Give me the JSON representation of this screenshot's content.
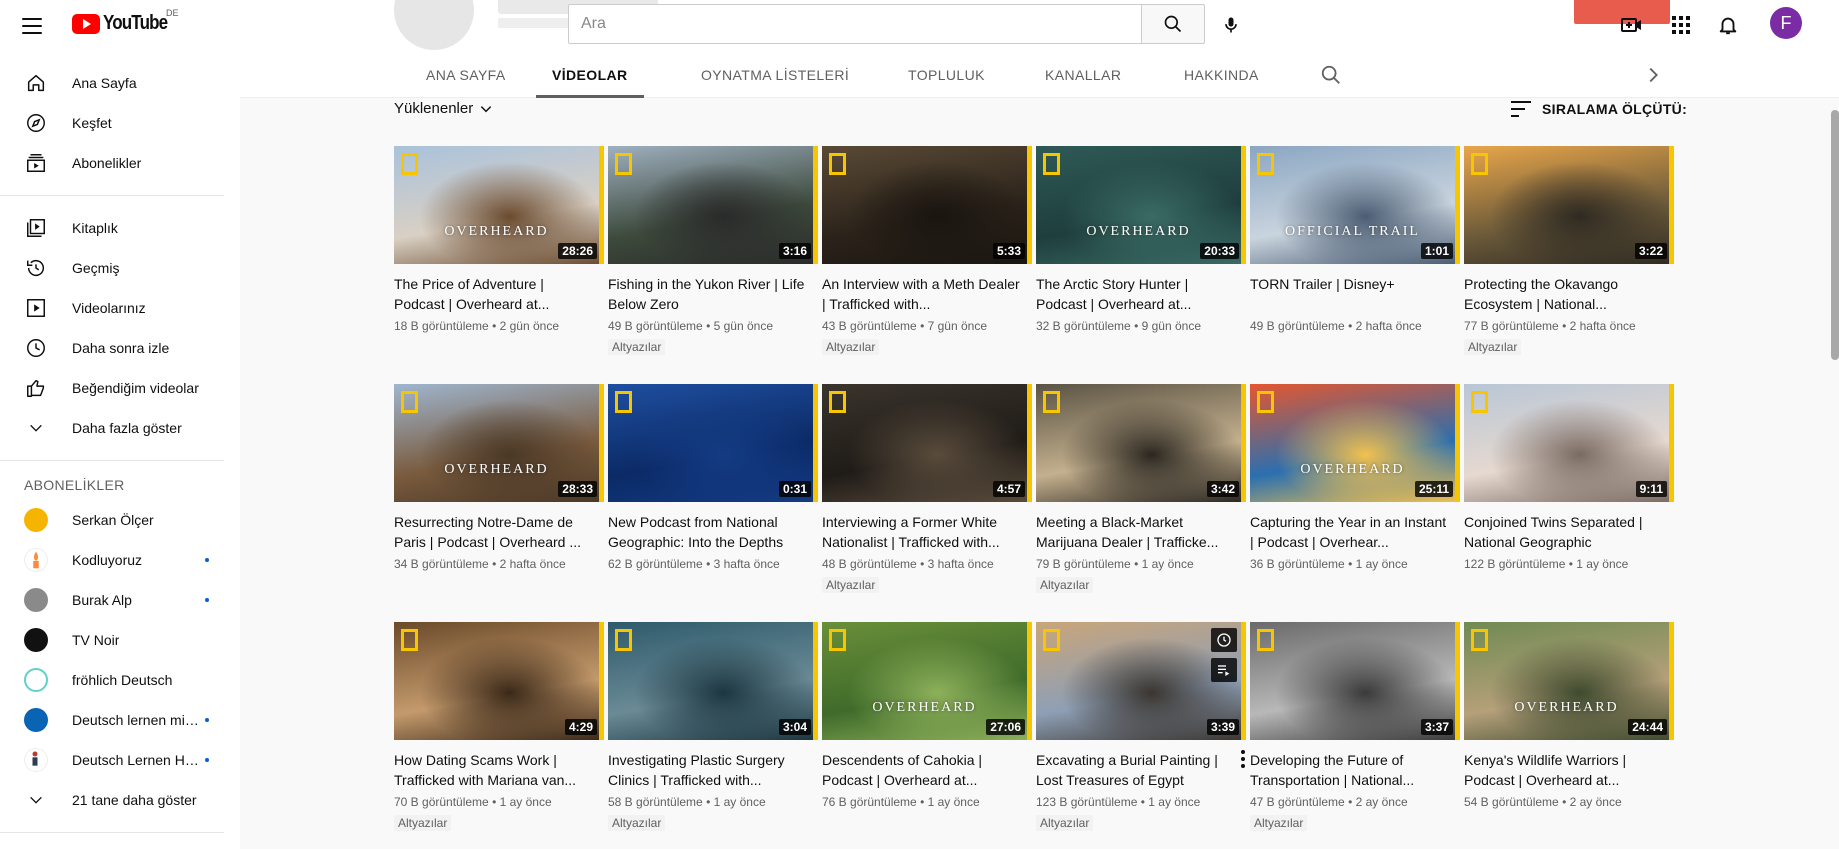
{
  "app": {
    "logo_text": "YouTube",
    "country_code": "DE",
    "avatar_letter": "F",
    "avatar_color": "#7b2ca5",
    "accent": "#ff0000"
  },
  "search": {
    "placeholder": "Ara",
    "value": ""
  },
  "sidebar": {
    "primary": [
      {
        "label": "Ana Sayfa",
        "icon": "home-icon"
      },
      {
        "label": "Keşfet",
        "icon": "compass-icon"
      },
      {
        "label": "Abonelikler",
        "icon": "subscriptions-icon"
      }
    ],
    "library": [
      {
        "label": "Kitaplık",
        "icon": "library-icon"
      },
      {
        "label": "Geçmiş",
        "icon": "history-icon"
      },
      {
        "label": "Videolarınız",
        "icon": "your-videos-icon"
      },
      {
        "label": "Daha sonra izle",
        "icon": "clock-icon"
      },
      {
        "label": "Beğendiğim videolar",
        "icon": "thumbs-up-icon"
      },
      {
        "label": "Daha fazla göster",
        "icon": "chevron-down-icon"
      }
    ],
    "subs_heading": "ABONELİKLER",
    "subscriptions": [
      {
        "label": "Serkan Ölçer",
        "color": "#f4b400",
        "dot": false
      },
      {
        "label": "Kodluyoruz",
        "color": "#ff8a3d",
        "dot": true
      },
      {
        "label": "Burak Alp",
        "color": "#8a8a8a",
        "dot": true
      },
      {
        "label": "TV Noir",
        "color": "#111111",
        "dot": false
      },
      {
        "label": "fröhlich Deutsch",
        "color": "#5fd1c8",
        "dot": false
      },
      {
        "label": "Deutsch lernen mit...",
        "color": "#0a64b4",
        "dot": true
      },
      {
        "label": "Deutsch Lernen Ha...",
        "color": "#c0392b",
        "dot": true
      }
    ],
    "show_more": "21 tane daha göster"
  },
  "tabs": [
    {
      "label": "ANA SAYFA",
      "active": false
    },
    {
      "label": "VİDEOLAR",
      "active": true
    },
    {
      "label": "OYNATMA LİSTELERİ",
      "active": false
    },
    {
      "label": "TOPLULUK",
      "active": false
    },
    {
      "label": "KANALLAR",
      "active": false
    },
    {
      "label": "HAKKINDA",
      "active": false
    }
  ],
  "filter_label": "Yüklenenler",
  "sort_label": "SIRALAMA ÖLÇÜTÜ:",
  "videos": [
    {
      "title": "The Price of Adventure | Podcast | Overheard at...",
      "views": "18 B görüntüleme",
      "age": "2 gün önce",
      "duration": "28:26",
      "captions": "",
      "overlay": "OVERHEARD",
      "colors": [
        "#a9c2dc",
        "#d9d0c4",
        "#6b4b2f"
      ]
    },
    {
      "title": "Fishing in the Yukon River | Life Below Zero",
      "views": "49 B görüntüleme",
      "age": "5 gün önce",
      "duration": "3:16",
      "captions": "Altyazılar",
      "overlay": "",
      "colors": [
        "#9fb0c0",
        "#3d4a3c",
        "#2a2a2a"
      ]
    },
    {
      "title": "An Interview with a Meth Dealer | Trafficked with...",
      "views": "43 B görüntüleme",
      "age": "7 gün önce",
      "duration": "5:33",
      "captions": "Altyazılar",
      "overlay": "",
      "colors": [
        "#5a4a36",
        "#2b231a",
        "#1a1510"
      ]
    },
    {
      "title": "The Arctic Story Hunter | Podcast | Overheard at...",
      "views": "32 B görüntüleme",
      "age": "9 gün önce",
      "duration": "20:33",
      "captions": "",
      "overlay": "OVERHEARD",
      "colors": [
        "#2f5a57",
        "#1e3e3c",
        "#3a6b66"
      ]
    },
    {
      "title": "TORN Trailer | Disney+",
      "views": "49 B görüntüleme",
      "age": "2 hafta önce",
      "duration": "1:01",
      "captions": "",
      "overlay": "OFFICIAL TRAIL",
      "colors": [
        "#8ba6c2",
        "#c9d4de",
        "#4b5d73"
      ]
    },
    {
      "title": "Protecting the Okavango Ecosystem | National...",
      "views": "77 B görüntüleme",
      "age": "2 hafta önce",
      "duration": "3:22",
      "captions": "Altyazılar",
      "overlay": "",
      "colors": [
        "#e9a64a",
        "#6b5a3a",
        "#2f2a22"
      ]
    },
    {
      "title": "Resurrecting Notre-Dame de Paris | Podcast | Overheard ...",
      "views": "34 B görüntüleme",
      "age": "2 hafta önce",
      "duration": "28:33",
      "captions": "",
      "overlay": "OVERHEARD",
      "colors": [
        "#9fb6cf",
        "#7a5b3e",
        "#4a3826"
      ]
    },
    {
      "title": "New Podcast from National Geographic: Into the Depths",
      "views": "62 B görüntüleme",
      "age": "3 hafta önce",
      "duration": "0:31",
      "captions": "",
      "overlay": "",
      "colors": [
        "#1f4fa0",
        "#0b2a66",
        "#143b84"
      ]
    },
    {
      "title": "Interviewing a Former White Nationalist | Trafficked with...",
      "views": "48 B görüntüleme",
      "age": "3 hafta önce",
      "duration": "4:57",
      "captions": "Altyazılar",
      "overlay": "",
      "colors": [
        "#3a342c",
        "#1f1b17",
        "#5a4c3c"
      ]
    },
    {
      "title": "Meeting a Black-Market Marijuana Dealer | Trafficke...",
      "views": "79 B görüntüleme",
      "age": "1 ay önce",
      "duration": "3:42",
      "captions": "Altyazılar",
      "overlay": "",
      "colors": [
        "#5a5344",
        "#c4b08e",
        "#2a2620"
      ]
    },
    {
      "title": "Capturing the Year in an Instant | Podcast | Overhear...",
      "views": "36 B görüntüleme",
      "age": "1 ay önce",
      "duration": "25:11",
      "captions": "",
      "overlay": "OVERHEARD",
      "colors": [
        "#e4572e",
        "#2a6fb0",
        "#f2c14e"
      ]
    },
    {
      "title": "Conjoined Twins Separated | National Geographic",
      "views": "122 B görüntüleme",
      "age": "1 ay önce",
      "duration": "9:11",
      "captions": "",
      "overlay": "",
      "colors": [
        "#b9c6d6",
        "#e6d9d0",
        "#7a6a62"
      ]
    },
    {
      "title": "How Dating Scams Work | Trafficked with Mariana van...",
      "views": "70 B görüntüleme",
      "age": "1 ay önce",
      "duration": "4:29",
      "captions": "Altyazılar",
      "overlay": "",
      "colors": [
        "#6b4a2a",
        "#c49a6c",
        "#3a2818"
      ]
    },
    {
      "title": "Investigating Plastic Surgery Clinics | Trafficked with...",
      "views": "58 B görüntüleme",
      "age": "1 ay önce",
      "duration": "3:04",
      "captions": "Altyazılar",
      "overlay": "",
      "colors": [
        "#2e5a6b",
        "#6a8a96",
        "#1c3640"
      ]
    },
    {
      "title": "Descendents of Cahokia | Podcast | Overheard at...",
      "views": "76 B görüntüleme",
      "age": "1 ay önce",
      "duration": "27:06",
      "captions": "",
      "overlay": "OVERHEARD",
      "colors": [
        "#6a8f3a",
        "#3f6b2a",
        "#8db05a"
      ]
    },
    {
      "title": "Excavating a Burial Painting | Lost Treasures of Egypt",
      "views": "123 B görüntüleme",
      "age": "1 ay önce",
      "duration": "3:39",
      "captions": "Altyazılar",
      "overlay": "",
      "colors": [
        "#c9a57a",
        "#8e9fb5",
        "#3a3530"
      ],
      "hover": true
    },
    {
      "title": "Developing the Future of Transportation | National...",
      "views": "47 B görüntüleme",
      "age": "2 ay önce",
      "duration": "3:37",
      "captions": "Altyazılar",
      "overlay": "",
      "colors": [
        "#6a6a6a",
        "#b8b8b8",
        "#3a3a3a"
      ]
    },
    {
      "title": "Kenya's Wildlife Warriors | Podcast | Overheard at...",
      "views": "54 B görüntüleme",
      "age": "2 ay önce",
      "duration": "24:44",
      "captions": "",
      "overlay": "OVERHEARD",
      "colors": [
        "#6f8a52",
        "#b5a07a",
        "#3e4a2e"
      ]
    }
  ]
}
